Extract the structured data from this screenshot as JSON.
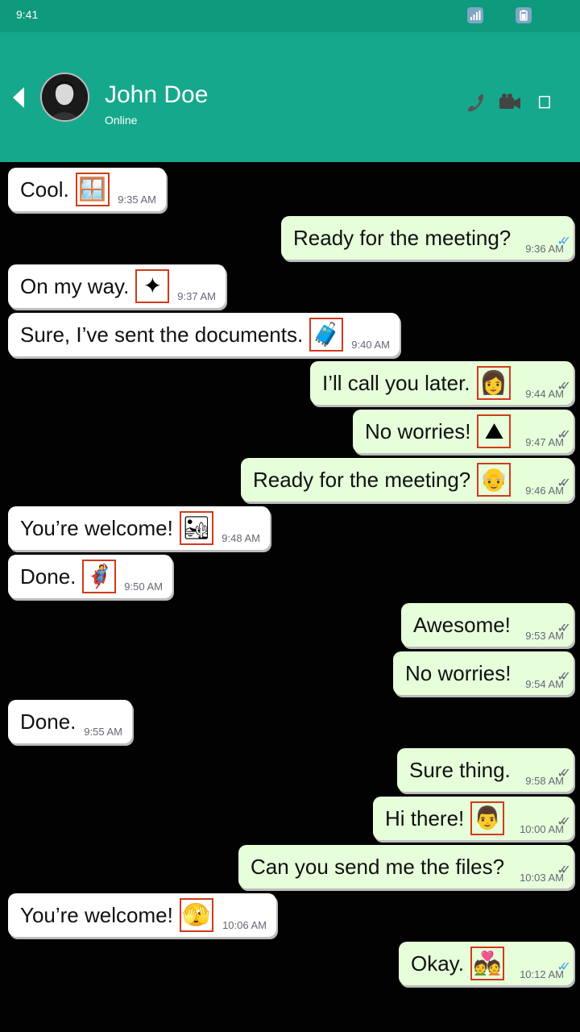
{
  "status_bar": {
    "time": "9:41",
    "icons": [
      "signal-icon",
      "battery-icon"
    ]
  },
  "header": {
    "contact_name": "John Doe",
    "contact_status": "Online",
    "icons": [
      "phone-icon",
      "video-camera-icon",
      "menu-icon"
    ]
  },
  "colors": {
    "status_bar": "#0e9a7d",
    "header": "#16a88c",
    "incoming": "#ffffff",
    "outgoing": "#e6ffda"
  },
  "messages": [
    {
      "dir": "in",
      "text": "Cool.",
      "emoji": "🪟",
      "emoji_name": "framed-picture-emoji",
      "time": "9:35 AM"
    },
    {
      "dir": "out",
      "text": "Ready for the meeting?",
      "emoji": "",
      "emoji_name": "",
      "time": "9:36 AM",
      "read": true
    },
    {
      "dir": "in",
      "text": "On my way.",
      "emoji": "✦",
      "emoji_name": "sparkle-emoji",
      "time": "9:37 AM"
    },
    {
      "dir": "in",
      "text": "Sure, I’ve sent the documents.",
      "emoji": "🧳",
      "emoji_name": "luggage-emoji",
      "time": "9:40 AM"
    },
    {
      "dir": "out",
      "text": "I’ll call you later.",
      "emoji": "👩",
      "emoji_name": "woman-emoji",
      "time": "9:44 AM",
      "read": false
    },
    {
      "dir": "out",
      "text": "No worries!",
      "emoji": "⛰",
      "emoji_name": "house-emoji",
      "time": "9:47 AM",
      "read": false
    },
    {
      "dir": "out",
      "text": "Ready for the meeting?",
      "emoji": "👴",
      "emoji_name": "person-emoji",
      "time": "9:46 AM",
      "read": false
    },
    {
      "dir": "in",
      "text": "You’re welcome!",
      "emoji": "🏜",
      "emoji_name": "desert-emoji",
      "time": "9:48 AM"
    },
    {
      "dir": "in",
      "text": "Done.",
      "emoji": "🦸",
      "emoji_name": "superhero-emoji",
      "time": "9:50 AM"
    },
    {
      "dir": "out",
      "text": "Awesome!",
      "emoji": "",
      "emoji_name": "",
      "time": "9:53 AM",
      "read": false
    },
    {
      "dir": "out",
      "text": "No worries!",
      "emoji": "",
      "emoji_name": "",
      "time": "9:54 AM",
      "read": false
    },
    {
      "dir": "in",
      "text": "Done.",
      "emoji": "",
      "emoji_name": "",
      "time": "9:55 AM"
    },
    {
      "dir": "out",
      "text": "Sure thing.",
      "emoji": "",
      "emoji_name": "",
      "time": "9:58 AM",
      "read": false
    },
    {
      "dir": "out",
      "text": "Hi there!",
      "emoji": "👨",
      "emoji_name": "man-emoji",
      "time": "10:00 AM",
      "read": false
    },
    {
      "dir": "out",
      "text": "Can you send me the files?",
      "emoji": "",
      "emoji_name": "",
      "time": "10:03 AM",
      "read": false
    },
    {
      "dir": "in",
      "text": "You’re welcome!",
      "emoji": "🫣",
      "emoji_name": "face-peeking-emoji",
      "time": "10:06 AM"
    },
    {
      "dir": "out",
      "text": "Okay.",
      "emoji": "💑",
      "emoji_name": "couple-heart-emoji",
      "time": "10:12 AM",
      "read": true
    }
  ]
}
